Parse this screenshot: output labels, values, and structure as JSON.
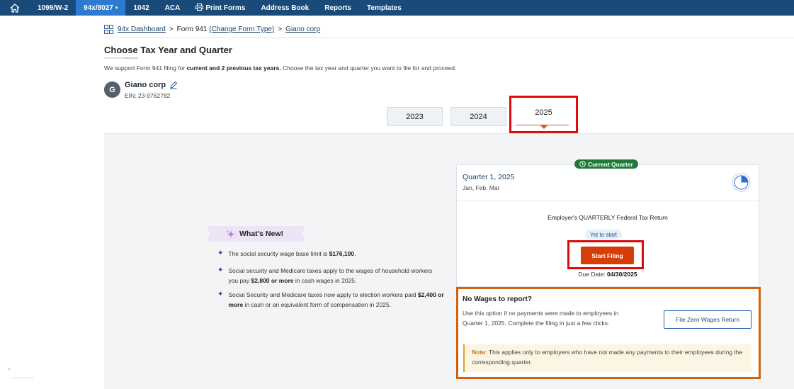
{
  "nav": {
    "items": [
      {
        "label": "1099/W-2",
        "active": false
      },
      {
        "label": "94x/8027",
        "active": true,
        "has_caret": true
      },
      {
        "label": "1042",
        "active": false
      },
      {
        "label": "ACA",
        "active": false
      },
      {
        "label": "Print Forms",
        "active": false,
        "icon": "printer-icon"
      },
      {
        "label": "Address Book",
        "active": false
      },
      {
        "label": "Reports",
        "active": false
      },
      {
        "label": "Templates",
        "active": false
      }
    ],
    "caret": "▾"
  },
  "breadcrumb": {
    "dashboard": "94x Dashboard",
    "form": "Form 941",
    "change_type": "(Change Form Type)",
    "company": "Giano corp",
    "sep": ">"
  },
  "page": {
    "title": "Choose Tax Year and Quarter",
    "subtitle_pre": "We support Form 941 filing for ",
    "subtitle_bold": "current and 2 previous tax years.",
    "subtitle_post": " Choose the tax year and quarter you want to file for and proceed."
  },
  "company": {
    "initial": "G",
    "name": "Giano corp",
    "ein": "EIN: 23-9762782"
  },
  "years": [
    {
      "label": "2023",
      "selected": false
    },
    {
      "label": "2024",
      "selected": false
    },
    {
      "label": "2025",
      "selected": true
    }
  ],
  "whats_new": {
    "title": "What's New!",
    "items": [
      {
        "pre": "The social security wage base limit is ",
        "bold": "$176,100",
        "post": "."
      },
      {
        "pre": "Social security and Medicare taxes apply to the wages of household workers you pay ",
        "bold": "$2,800 or more",
        "post": " in cash wages in 2025."
      },
      {
        "pre": "Social Security and Medicare taxes now apply to election workers paid ",
        "bold": "$2,400 or more",
        "post": " in cash or an equivalent form of compensation in 2025."
      }
    ]
  },
  "quarter": {
    "badge": "Current Quarter",
    "title": "Quarter 1, 2025",
    "months": "Jan, Feb, Mar",
    "progress_fraction": 0.25,
    "return_name": "Employer's QUARTERLY Federal Tax Return",
    "status": "Yet to start",
    "start_label": "Start Filing",
    "due_label": "Due Date: ",
    "due_date": "04/30/2025"
  },
  "no_wages": {
    "title": "No Wages to report?",
    "description": "Use this option if no payments were made to employees in Quarter 1, 2025. Complete the filing in just a few clicks.",
    "button": "File Zero Wages Return",
    "note_label": "Note:",
    "note_text": " This applies only to employers who have not made any payments to their employees during the corresponding quarter."
  },
  "colors": {
    "nav_bg": "#1a4a7a",
    "nav_active": "#2d7ad0",
    "highlight_red": "#dd0b0b",
    "highlight_orange": "#d4610d",
    "start_btn": "#d63e07",
    "badge_green": "#1f7a3a",
    "pie_blue": "#2b6fd6"
  }
}
